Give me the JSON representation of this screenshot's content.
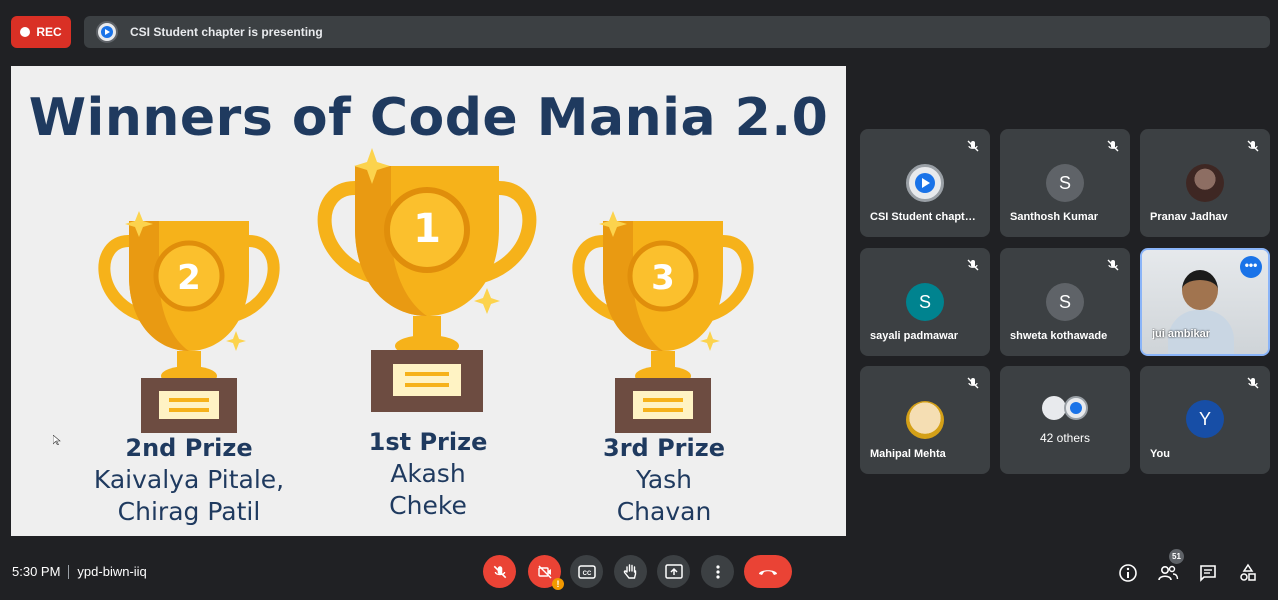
{
  "top": {
    "rec_label": "REC",
    "presenting_text": "CSI Student chapter is presenting"
  },
  "slide": {
    "title": "Winners of Code Mania 2.0",
    "prizes": [
      {
        "title": "2nd Prize",
        "winner": "Kaivalya Pitale,\nChirag Patil",
        "number": "2"
      },
      {
        "title": "1st Prize",
        "winner": "Akash\nCheke",
        "number": "1"
      },
      {
        "title": "3rd Prize",
        "winner": "Yash\nChavan",
        "number": "3"
      }
    ]
  },
  "participants": [
    {
      "name": "CSI Student chapt…",
      "avatar": "logo"
    },
    {
      "name": "Santhosh Kumar",
      "avatar": "S",
      "avatar_color": "#5f6368"
    },
    {
      "name": "Pranav Jadhav",
      "avatar": "photo"
    },
    {
      "name": "sayali padmawar",
      "avatar": "S",
      "avatar_color": "#00838f"
    },
    {
      "name": "shweta kothawade",
      "avatar": "S",
      "avatar_color": "#5f6368"
    },
    {
      "name": "jui ambikar",
      "avatar": "video"
    },
    {
      "name": "Mahipal Mehta",
      "avatar": "photo"
    },
    {
      "name": "42 others",
      "avatar": "group"
    },
    {
      "name": "You",
      "avatar": "Y",
      "avatar_color": "#174ea6"
    }
  ],
  "bottom": {
    "time": "5:30 PM",
    "meeting_code": "ypd-biwn-iiq",
    "people_count": "51"
  },
  "colors": {
    "accent_red": "#ea4335",
    "accent_blue": "#1a73e8",
    "slide_title": "#1f3a5f",
    "trophy_gold": "#f6b21a"
  }
}
